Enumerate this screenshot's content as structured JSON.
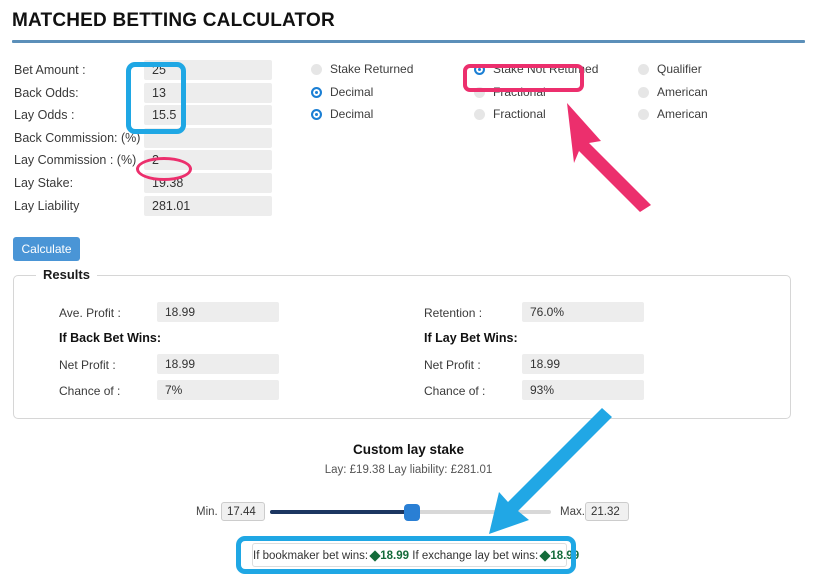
{
  "header": {
    "title": "MATCHED BETTING CALCULATOR"
  },
  "form": {
    "rows": [
      {
        "label": "Bet Amount :",
        "value": "25"
      },
      {
        "label": "Back Odds:",
        "value": "13"
      },
      {
        "label": "Lay Odds :",
        "value": "15.5"
      },
      {
        "label": "Back Commission: (%)",
        "value": ""
      },
      {
        "label": "Lay Commission : (%)",
        "value": "2"
      },
      {
        "label": "Lay Stake:",
        "value": "19.38"
      },
      {
        "label": "Lay Liability",
        "value": "281.01"
      }
    ],
    "calculate_label": "Calculate"
  },
  "options": {
    "column1": [
      {
        "label": "Stake Returned",
        "selected": false
      },
      {
        "label": "Decimal",
        "selected": true
      },
      {
        "label": "Decimal",
        "selected": true
      }
    ],
    "column2": [
      {
        "label": "Stake Not Returned",
        "selected": true
      },
      {
        "label": "Fractional",
        "selected": false
      },
      {
        "label": "Fractional",
        "selected": false
      }
    ],
    "column3": [
      {
        "label": "Qualifier",
        "selected": false
      },
      {
        "label": "American",
        "selected": false
      },
      {
        "label": "American",
        "selected": false
      }
    ]
  },
  "results": {
    "legend": "Results",
    "left": {
      "top": {
        "label": "Ave. Profit :",
        "value": "18.99"
      },
      "heading": "If Back Bet Wins:",
      "rows": [
        {
          "label": "Net Profit :",
          "value": "18.99"
        },
        {
          "label": "Chance of :",
          "value": "7%"
        }
      ]
    },
    "right": {
      "top": {
        "label": "Retention :",
        "value": "76.0%"
      },
      "heading": "If Lay Bet Wins:",
      "rows": [
        {
          "label": "Net Profit :",
          "value": "18.99"
        },
        {
          "label": "Chance of :",
          "value": "93%"
        }
      ]
    }
  },
  "custom_lay_stake": {
    "title": "Custom lay stake",
    "subtitle": "Lay: £19.38 Lay liability: £281.01",
    "min_label": "Min.",
    "min_value": "17.44",
    "max_label": "Max.",
    "max_value": "21.32",
    "slider_position_percent": 48
  },
  "outcome": {
    "bookmaker_text": "If bookmaker bet wins:",
    "bookmaker_amount": "18.99",
    "exchange_text": "If exchange lay bet wins:",
    "exchange_amount": "18.99",
    "currency_glyph": "missing-glyph-box"
  },
  "annotations": {
    "blue_color": "#1fa7e4",
    "pink_color": "#ec2f6d",
    "items": [
      {
        "name": "blue-highlight-odds-inputs",
        "shape": "rounded-rect"
      },
      {
        "name": "blue-highlight-outcome-bar",
        "shape": "rounded-rect"
      },
      {
        "name": "pink-highlight-stake-not-returned",
        "shape": "rounded-rect"
      },
      {
        "name": "pink-highlight-lay-commission",
        "shape": "oval"
      },
      {
        "name": "pink-arrow-up-left",
        "shape": "arrow"
      },
      {
        "name": "blue-arrow-down-left",
        "shape": "arrow"
      }
    ]
  }
}
